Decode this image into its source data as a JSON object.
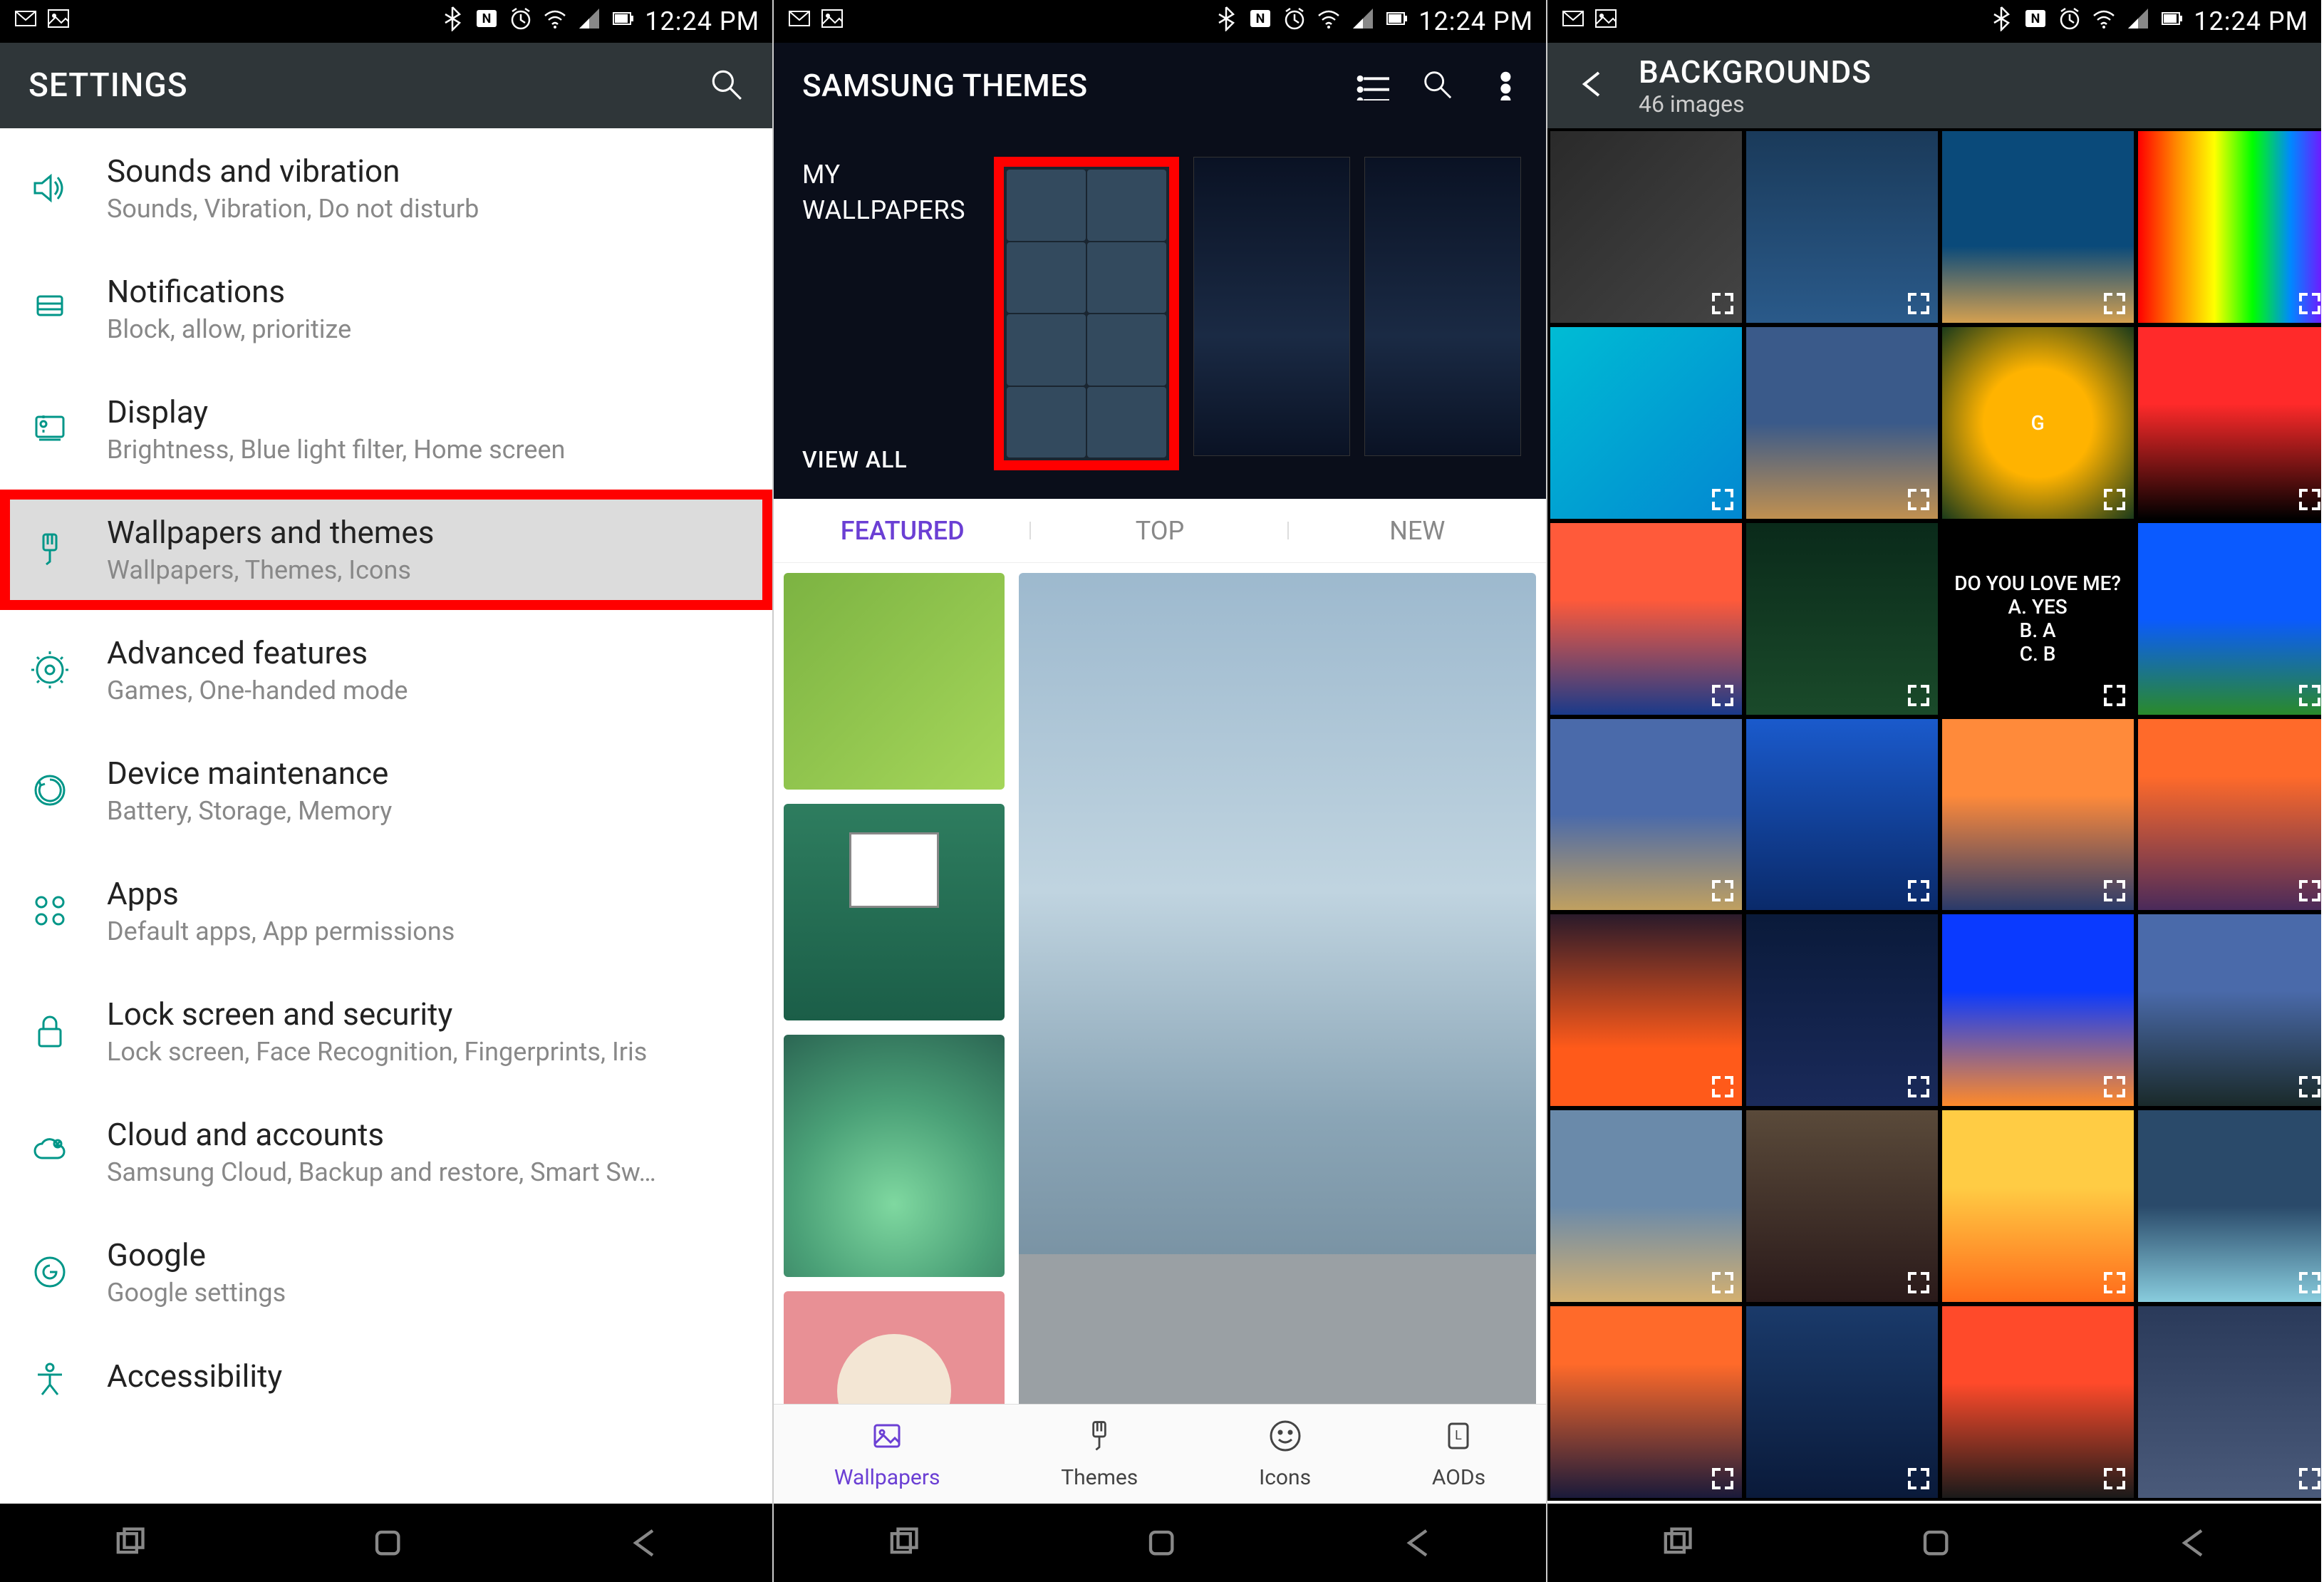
{
  "status": {
    "time": "12:24 PM",
    "icons_left": [
      "gmail-icon",
      "picture-icon"
    ],
    "icons_right": [
      "bluetooth-icon",
      "nfc-icon",
      "alarm-icon",
      "wifi-icon",
      "signal-icon",
      "battery-icon"
    ]
  },
  "screen1": {
    "header_title": "SETTINGS",
    "items": [
      {
        "icon": "volume-icon",
        "title": "Sounds and vibration",
        "sub": "Sounds, Vibration, Do not disturb",
        "highlighted": false
      },
      {
        "icon": "notifications-icon",
        "title": "Notifications",
        "sub": "Block, allow, prioritize",
        "highlighted": false
      },
      {
        "icon": "display-icon",
        "title": "Display",
        "sub": "Brightness, Blue light filter, Home screen",
        "highlighted": false
      },
      {
        "icon": "brush-icon",
        "title": "Wallpapers and themes",
        "sub": "Wallpapers, Themes, Icons",
        "highlighted": true
      },
      {
        "icon": "advanced-icon",
        "title": "Advanced features",
        "sub": "Games, One-handed mode",
        "highlighted": false
      },
      {
        "icon": "maintenance-icon",
        "title": "Device maintenance",
        "sub": "Battery, Storage, Memory",
        "highlighted": false
      },
      {
        "icon": "apps-icon",
        "title": "Apps",
        "sub": "Default apps, App permissions",
        "highlighted": false
      },
      {
        "icon": "lock-icon",
        "title": "Lock screen and security",
        "sub": "Lock screen, Face Recognition, Fingerprints, Iris",
        "highlighted": false
      },
      {
        "icon": "cloud-icon",
        "title": "Cloud and accounts",
        "sub": "Samsung Cloud, Backup and restore, Smart Sw…",
        "highlighted": false
      },
      {
        "icon": "google-icon",
        "title": "Google",
        "sub": "Google settings",
        "highlighted": false
      },
      {
        "icon": "accessibility-icon",
        "title": "Accessibility",
        "sub": "",
        "highlighted": false
      }
    ]
  },
  "screen2": {
    "header_title": "SAMSUNG THEMES",
    "my_wallpapers_label": "MY\nWALLPAPERS",
    "view_all_label": "VIEW ALL",
    "tabs": [
      {
        "label": "FEATURED",
        "active": true
      },
      {
        "label": "TOP",
        "active": false
      },
      {
        "label": "NEW",
        "active": false
      }
    ],
    "bottom_nav": [
      {
        "label": "Wallpapers",
        "icon": "image-icon",
        "active": true
      },
      {
        "label": "Themes",
        "icon": "brush-icon",
        "active": false
      },
      {
        "label": "Icons",
        "icon": "smile-icon",
        "active": false
      },
      {
        "label": "AODs",
        "icon": "aod-icon",
        "active": false
      }
    ]
  },
  "screen3": {
    "header_title": "BACKGROUNDS",
    "header_sub": "46 images",
    "thumbnails": [
      {
        "bg": "linear-gradient(135deg,#2a2a2a,#444)",
        "label": ""
      },
      {
        "bg": "linear-gradient(180deg,#1a3a5a,#2a5a8a)",
        "label": ""
      },
      {
        "bg": "linear-gradient(180deg,#0a4a7a 60%,#d4a050)",
        "label": ""
      },
      {
        "bg": "linear-gradient(90deg,#ff0000,#ff8800,#ffff00,#00ff00,#0088ff,#8800ff)",
        "label": ""
      },
      {
        "bg": "linear-gradient(135deg,#00bcd4,#0288d1)",
        "label": ""
      },
      {
        "bg": "linear-gradient(180deg,#3a5a8a 50%,#c09050)",
        "label": ""
      },
      {
        "bg": "radial-gradient(circle,#ffb300 40%,#1a3a1a)",
        "label": "G"
      },
      {
        "bg": "linear-gradient(180deg,#ff2a2a 40%,#000)",
        "label": ""
      },
      {
        "bg": "linear-gradient(180deg,#ff5a3a 40%,#1a3a8a)",
        "label": ""
      },
      {
        "bg": "linear-gradient(180deg,#0a2a1a,#1a4a2a)",
        "label": ""
      },
      {
        "bg": "#000",
        "label": "DO YOU LOVE ME?\nA. YES\nB. A\nC. B"
      },
      {
        "bg": "linear-gradient(180deg,#0a5aff 50%,#2a8a2a)",
        "label": ""
      },
      {
        "bg": "linear-gradient(180deg,#4a6aaa 50%,#c0a060)",
        "label": ""
      },
      {
        "bg": "linear-gradient(180deg,#1a5acc,#0a2a6a)",
        "label": ""
      },
      {
        "bg": "linear-gradient(180deg,#ff8a3a 40%,#2a3a6a)",
        "label": ""
      },
      {
        "bg": "linear-gradient(180deg,#ff6a2a 30%,#4a2a5a)",
        "label": ""
      },
      {
        "bg": "linear-gradient(180deg,#2a1a2a,#ff5a1a 70%)",
        "label": ""
      },
      {
        "bg": "linear-gradient(180deg,#0a1a3a,#1a2a5a)",
        "label": ""
      },
      {
        "bg": "linear-gradient(180deg,#0a3aff 40%,#ff8a2a)",
        "label": ""
      },
      {
        "bg": "linear-gradient(180deg,#4a6aaa 40%,#1a2a2a)",
        "label": ""
      },
      {
        "bg": "linear-gradient(180deg,#6a8aaa 50%,#d4b070)",
        "label": ""
      },
      {
        "bg": "linear-gradient(180deg,#5a4a3a,#2a1a1a)",
        "label": ""
      },
      {
        "bg": "linear-gradient(180deg,#ffcc44 40%,#ff6a1a)",
        "label": ""
      },
      {
        "bg": "linear-gradient(180deg,#2a4a6a 50%,#88ccdd)",
        "label": ""
      },
      {
        "bg": "linear-gradient(180deg,#ff6a2a 30%,#1a1a3a)",
        "label": ""
      },
      {
        "bg": "linear-gradient(180deg,#1a3a6a,#0a1a3a)",
        "label": ""
      },
      {
        "bg": "linear-gradient(180deg,#ff4a2a 40%,#1a1a1a)",
        "label": ""
      },
      {
        "bg": "linear-gradient(180deg,#2a3a5a,#4a5a7a)",
        "label": ""
      }
    ]
  }
}
